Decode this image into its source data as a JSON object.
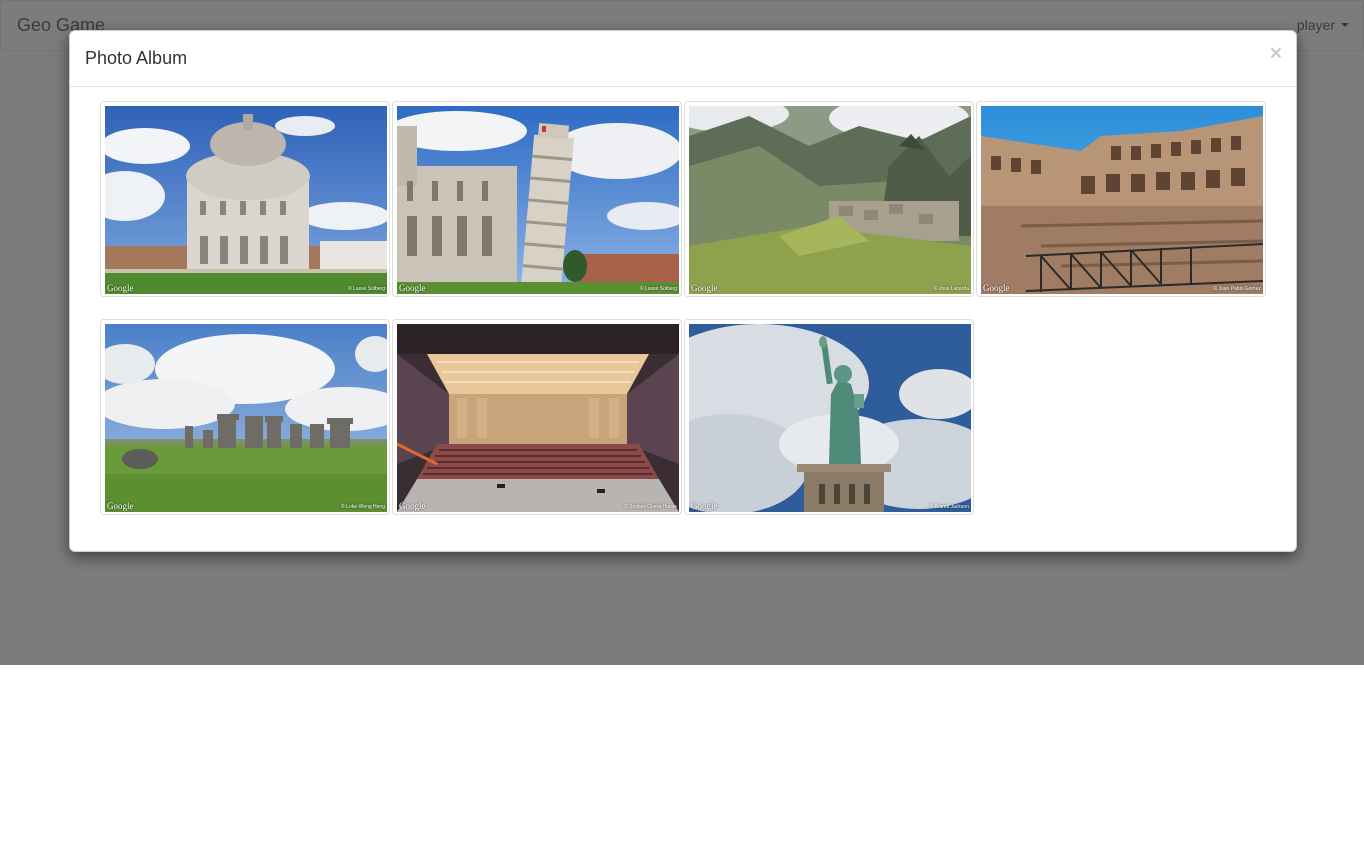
{
  "navbar": {
    "brand": "Geo Game",
    "user_label": "player"
  },
  "modal": {
    "title": "Photo Album",
    "close_symbol": "×",
    "photos": [
      {
        "subject": "Pisa Baptistery",
        "watermark": "Google",
        "credit": "© Lasse Solberg"
      },
      {
        "subject": "Leaning Tower of Pisa",
        "watermark": "Google",
        "credit": "© Lasse Solberg"
      },
      {
        "subject": "Machu Picchu",
        "watermark": "Google",
        "credit": "© Jose Lacerda"
      },
      {
        "subject": "Colosseum",
        "watermark": "Google",
        "credit": "© Juan Pablo Gomez"
      },
      {
        "subject": "Stonehenge",
        "watermark": "Google",
        "credit": "© Loke-Weng Heng"
      },
      {
        "subject": "Concert hall auditorium",
        "watermark": "Google",
        "credit": "© Sydney Opera House"
      },
      {
        "subject": "Statue of Liberty",
        "watermark": "Google",
        "credit": "© Brandt Jackson"
      }
    ]
  },
  "colors": {
    "backdrop": "#808080",
    "sky": "#3d74c6",
    "grass": "#6a9a3a"
  }
}
